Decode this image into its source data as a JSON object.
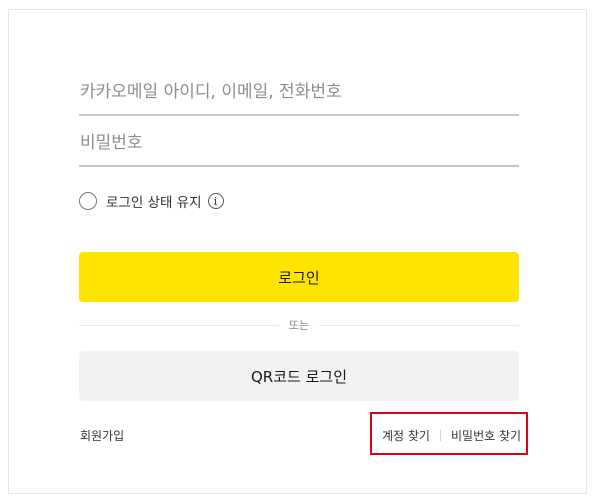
{
  "form": {
    "id_placeholder": "카카오메일 아이디, 이메일, 전화번호",
    "pw_placeholder": "비밀번호",
    "keep_login_label": "로그인 상태 유지",
    "info_glyph": "i",
    "login_button": "로그인",
    "divider_text": "또는",
    "qr_button": "QR코드 로그인"
  },
  "footer": {
    "signup": "회원가입",
    "find_account": "계정 찾기",
    "find_password": "비밀번호 찾기"
  },
  "colors": {
    "login_button": "#fee500",
    "qr_button": "#f2f2f2",
    "highlight_box": "#e0001a"
  }
}
